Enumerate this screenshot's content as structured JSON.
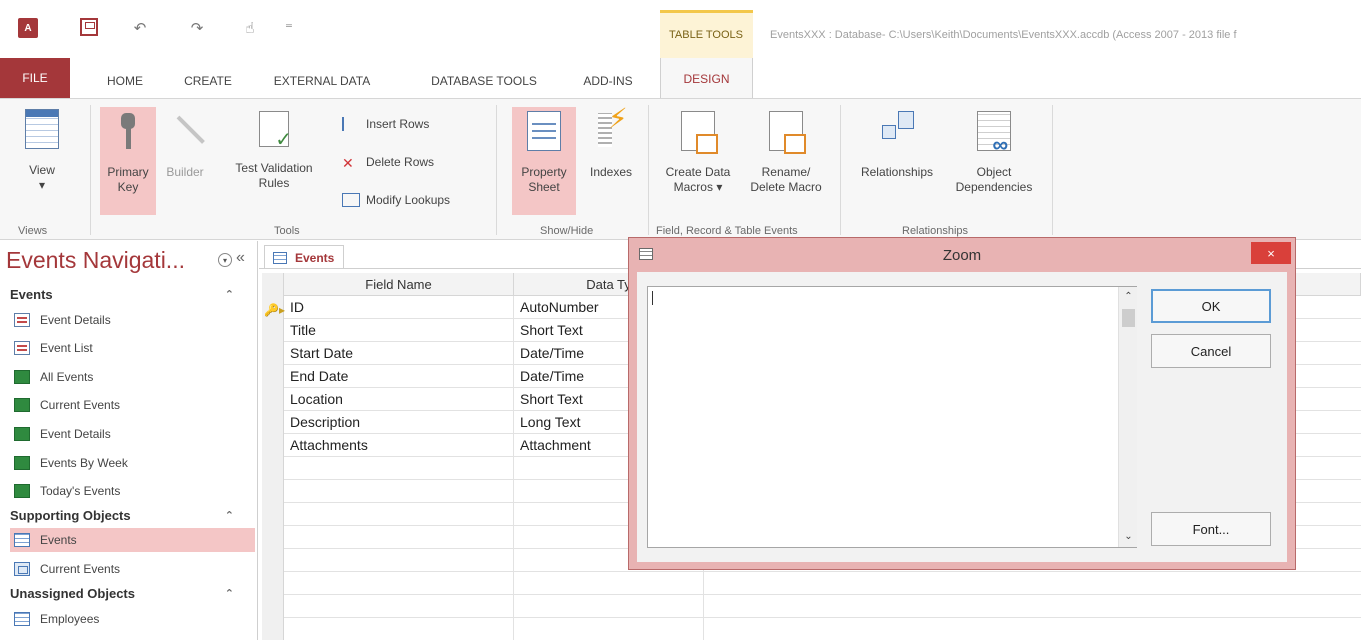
{
  "titlebar": {
    "app_logo": "A",
    "table_tools_label": "TABLE TOOLS",
    "window_title": "EventsXXX : Database- C:\\Users\\Keith\\Documents\\EventsXXX.accdb (Access 2007 - 2013 file f"
  },
  "tabs": [
    "FILE",
    "HOME",
    "CREATE",
    "EXTERNAL DATA",
    "DATABASE TOOLS",
    "ADD-INS",
    "DESIGN"
  ],
  "ribbon": {
    "view": "View",
    "view_arrow": "▾",
    "primary_key_1": "Primary",
    "primary_key_2": "Key",
    "builder": "Builder",
    "test_validation_1": "Test Validation",
    "test_validation_2": "Rules",
    "insert_rows": "Insert Rows",
    "delete_rows": "Delete Rows",
    "modify_lookups": "Modify Lookups",
    "property_sheet_1": "Property",
    "property_sheet_2": "Sheet",
    "indexes": "Indexes",
    "create_data_macros_1": "Create Data",
    "create_data_macros_2": "Macros ▾",
    "rename_delete_macro_1": "Rename/",
    "rename_delete_macro_2": "Delete Macro",
    "relationships": "Relationships",
    "object_dependencies_1": "Object",
    "object_dependencies_2": "Dependencies",
    "groups": {
      "views": "Views",
      "tools": "Tools",
      "show_hide": "Show/Hide",
      "field_record_table_events": "Field, Record & Table Events",
      "relationships": "Relationships"
    }
  },
  "nav": {
    "title": "Events Navigati...",
    "dropdown": "▾",
    "collapse": "«",
    "groups": [
      {
        "label": "Events",
        "chevron": "⌃"
      },
      {
        "label": "Supporting Objects",
        "chevron": "⌃"
      },
      {
        "label": "Unassigned Objects",
        "chevron": "⌃"
      }
    ],
    "events_items": [
      {
        "label": "Event Details",
        "type": "form"
      },
      {
        "label": "Event List",
        "type": "form"
      },
      {
        "label": "All Events",
        "type": "report"
      },
      {
        "label": "Current Events",
        "type": "report"
      },
      {
        "label": "Event Details",
        "type": "report"
      },
      {
        "label": "Events By Week",
        "type": "report"
      },
      {
        "label": "Today's Events",
        "type": "report"
      }
    ],
    "supporting_items": [
      {
        "label": "Events",
        "type": "table"
      },
      {
        "label": "Current Events",
        "type": "query"
      }
    ],
    "unassigned_items": [
      {
        "label": "Employees",
        "type": "table"
      }
    ]
  },
  "document": {
    "tab_label": "Events",
    "columns": [
      "Field Name",
      "Data Ty"
    ],
    "rows": [
      {
        "field": "ID",
        "type": "AutoNumber",
        "primary_key": true
      },
      {
        "field": "Title",
        "type": "Short Text"
      },
      {
        "field": "Start Date",
        "type": "Date/Time"
      },
      {
        "field": "End Date",
        "type": "Date/Time"
      },
      {
        "field": "Location",
        "type": "Short Text"
      },
      {
        "field": "Description",
        "type": "Long Text"
      },
      {
        "field": "Attachments",
        "type": "Attachment"
      }
    ]
  },
  "zoom": {
    "title": "Zoom",
    "close": "×",
    "text_value": "",
    "ok": "OK",
    "cancel": "Cancel",
    "font": "Font...",
    "scroll_up": "⌃",
    "scroll_down": "⌄"
  },
  "colors": {
    "accent": "#a4373a",
    "highlight": "#f4c6c6",
    "dialog_border": "#e8b3b3",
    "close_button": "#d9403a"
  }
}
